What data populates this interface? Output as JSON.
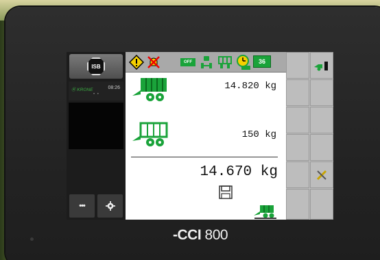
{
  "device": {
    "model": "CCI 800",
    "logo_mark": "-CCI",
    "logo_num": "800"
  },
  "left_panel": {
    "isb_label": "ISB",
    "brand": "Ⓚ KRONE",
    "time": "08:26",
    "dots": "• •",
    "menu_label": "•••",
    "settings_icon": "gear-icon"
  },
  "toolbar": {
    "icons": [
      "warning-diamond-icon",
      "crossed-bell-icon",
      "off-indicator-icon",
      "lock-axle-icon",
      "cart-icon",
      "clock-off-icon",
      "counter-icon"
    ],
    "off_label": "OFF",
    "counter_label": "36"
  },
  "weights": {
    "gross": {
      "value": "14.820",
      "unit": "kg"
    },
    "tare": {
      "value": "150",
      "unit": "kg"
    },
    "net": {
      "value": "14.670",
      "unit": "kg"
    }
  },
  "softkeys": {
    "count_right_col": 6,
    "icons": [
      "wagon-exit-icon",
      "wrench-pencil-icon",
      "wagon-weigh-icon",
      "save-icon"
    ]
  },
  "colors": {
    "accent_green": "#1aa33a",
    "toolbar": "#a9a9a9",
    "softkey": "#bdbdbd"
  }
}
